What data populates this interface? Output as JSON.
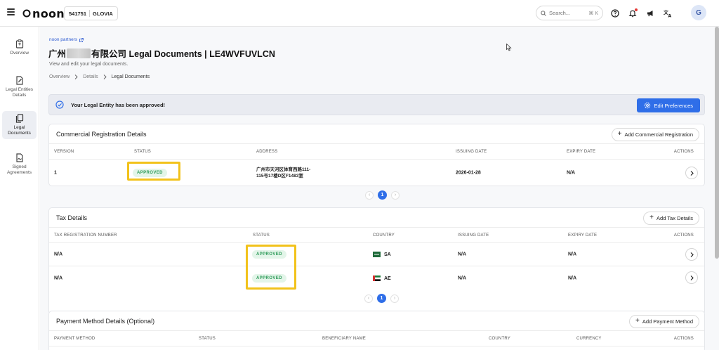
{
  "topbar": {
    "logo_text": "noon",
    "store_id": "541751",
    "store_name": "GLOVIA",
    "search_placeholder": "Search...",
    "search_shortcut": "⌘ K",
    "avatar_initial": "G"
  },
  "sidebar": {
    "items": [
      {
        "label": "Overview",
        "icon": "clipboard-icon"
      },
      {
        "label": "Legal Entities Details",
        "icon": "document-edit-icon"
      },
      {
        "label": "Legal Documents",
        "icon": "documents-icon",
        "active": true
      },
      {
        "label": "Signed Agreements",
        "icon": "signed-document-icon"
      }
    ]
  },
  "header": {
    "partners_link": "noon partners",
    "title_prefix": "广州",
    "title_suffix": "有限公司 Legal Documents | LE4WVFUVLCN",
    "subtitle": "View and edit your legal documents.",
    "breadcrumb": [
      "Overview",
      "Details",
      "Legal Documents"
    ]
  },
  "banner": {
    "text": "Your Legal Entity has been approved!",
    "button_label": "Edit Preferences"
  },
  "commercial": {
    "title": "Commercial Registration Details",
    "add_button": "Add Commercial Registration",
    "columns": [
      "VERSION",
      "STATUS",
      "ADDRESS",
      "ISSUING DATE",
      "EXPIRY DATE",
      "ACTIONS"
    ],
    "rows": [
      {
        "version": "1",
        "status": "APPROVED",
        "address_line1": "广州市天河区体育西路111-",
        "address_line2": "115号17楼D区F1483室",
        "issuing_date": "2026-01-28",
        "expiry_date": "N/A"
      }
    ],
    "page": "1"
  },
  "tax": {
    "title": "Tax Details",
    "add_button": "Add Tax Details",
    "columns": [
      "TAX REGISTRATION NUMBER",
      "STATUS",
      "COUNTRY",
      "ISSUING DATE",
      "EXPIRY DATE",
      "ACTIONS"
    ],
    "rows": [
      {
        "number": "N/A",
        "status": "APPROVED",
        "country": "SA",
        "issuing_date": "N/A",
        "expiry_date": "N/A"
      },
      {
        "number": "N/A",
        "status": "APPROVED",
        "country": "AE",
        "issuing_date": "N/A",
        "expiry_date": "N/A"
      }
    ],
    "page": "1"
  },
  "payment": {
    "title": "Payment Method Details (Optional)",
    "add_button": "Add Payment Method",
    "columns": [
      "PAYMENT METHOD",
      "STATUS",
      "BENEFICIARY NAME",
      "COUNTRY",
      "CURRENCY",
      "ACTIONS"
    ]
  },
  "colors": {
    "primary": "#2f6ee8",
    "approved_bg": "#e3f5e9",
    "approved_text": "#2b9a57",
    "highlight": "#f2c21b"
  }
}
